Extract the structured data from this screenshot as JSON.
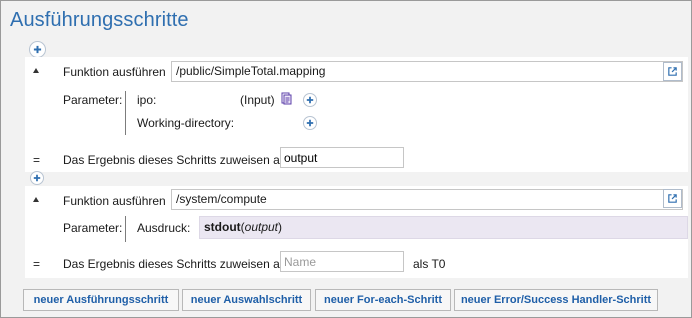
{
  "title": "Ausführungsschritte",
  "steps": [
    {
      "function_label": "Funktion ausführen",
      "function_value": "/public/SimpleTotal.mapping",
      "params_label": "Parameter:",
      "params": [
        {
          "name": "ipo:",
          "type": "(Input)"
        },
        {
          "name": "Working-directory:",
          "type": ""
        }
      ],
      "assign_label": "Das Ergebnis dieses Schritts zuweisen an",
      "assign_value": "output",
      "eq": "="
    },
    {
      "function_label": "Funktion ausführen",
      "function_value": "/system/compute",
      "params_label": "Parameter:",
      "expr_label": "Ausdruck:",
      "expr_func": "stdout",
      "expr_arg": "output",
      "assign_label": "Das Ergebnis dieses Schritts zuweisen an",
      "assign_placeholder": "Name",
      "assign_suffix": "als T0",
      "eq": "="
    }
  ],
  "buttons": {
    "new_exec": "neuer Ausführungsschritt",
    "new_choice": "neuer Auswahlschritt",
    "new_foreach": "neuer For-each-Schritt",
    "new_handler": "neuer Error/Success Handler-Schritt"
  },
  "colors": {
    "title": "#2f6fb0",
    "plus": "#2f6fb0",
    "expr_bg": "#ebe7f2",
    "button_text": "#1f5fa8"
  },
  "icons": [
    "plus-icon",
    "chevron-down-icon",
    "open-external-icon",
    "mapping-file-icon"
  ]
}
